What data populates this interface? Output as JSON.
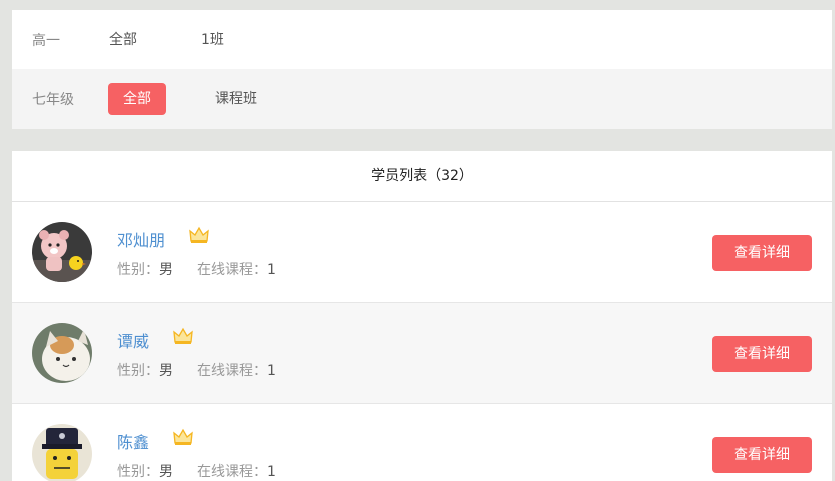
{
  "filters": {
    "row1": {
      "label": "高一",
      "options": [
        "全部",
        "1班"
      ]
    },
    "row2": {
      "label": "七年级",
      "options": [
        "全部",
        "课程班"
      ],
      "selected": "全部"
    }
  },
  "list": {
    "header": "学员列表（32）",
    "gender_label": "性别：",
    "course_label": "在线课程：",
    "detail_button": "查看详细",
    "students": [
      {
        "name": "邓灿朋",
        "gender": "男",
        "courses": "1",
        "avatar": "pink-bear-toy-avatar"
      },
      {
        "name": "谭威",
        "gender": "男",
        "courses": "1",
        "avatar": "cartoon-cat-avatar"
      },
      {
        "name": "陈鑫",
        "gender": "男",
        "courses": "1",
        "avatar": "lego-police-avatar"
      }
    ]
  },
  "colors": {
    "accent": "#f66163",
    "name_link": "#4e8fd0",
    "crown": "#f5b622",
    "background": "#e3e4e1"
  },
  "icons": {
    "vip": "crown-icon"
  }
}
